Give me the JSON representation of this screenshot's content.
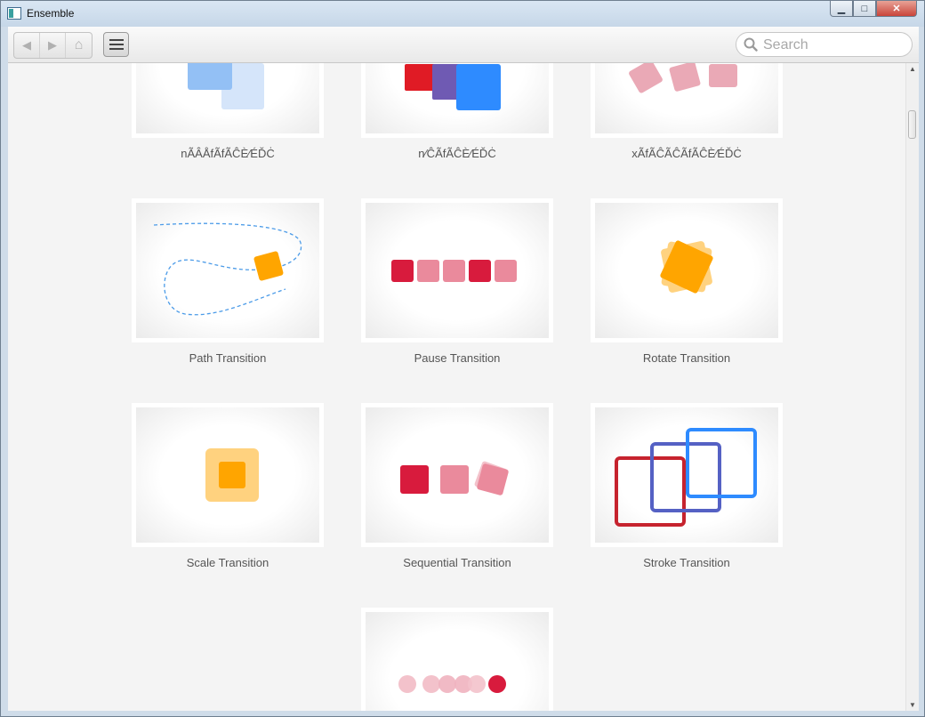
{
  "window": {
    "title": "Ensemble",
    "controls": {
      "minimize": "▁",
      "maximize": "□",
      "close": "✕"
    }
  },
  "toolbar": {
    "back_icon": "◀",
    "forward_icon": "▶",
    "home_icon": "⌂",
    "menu_icon": "hamburger-menu",
    "search_placeholder": "Search"
  },
  "samples": [
    {
      "label": "nÃÂÅfÃfÃĈÈ⁄ÉĎĊ"
    },
    {
      "label": "n⁄ĈÃfÃĈÈ⁄ÉĎĊ"
    },
    {
      "label": "xÃfÃĈÃĈÃfÃĈÈ⁄ÉĎĊ"
    },
    {
      "label": "Path Transition"
    },
    {
      "label": "Pause Transition"
    },
    {
      "label": "Rotate Transition"
    },
    {
      "label": "Scale Transition"
    },
    {
      "label": "Sequential Transition"
    },
    {
      "label": "Stroke Transition"
    },
    {
      "label": ""
    }
  ],
  "colors": {
    "crimson": "#d81b3d",
    "pink": "#ea8a9c",
    "orange": "#ffa500",
    "light_orange": "#ffd27f",
    "blue": "#2e8bff",
    "indigo": "#5561c4",
    "red": "#c6232e",
    "light_blue": "#93c0f5"
  }
}
